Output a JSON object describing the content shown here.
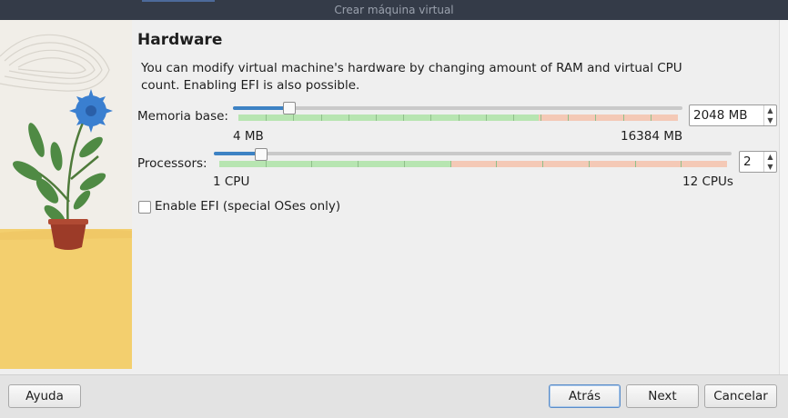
{
  "window": {
    "title": "Crear máquina virtual"
  },
  "page": {
    "heading": "Hardware",
    "description_line1": "You can modify virtual machine's hardware by changing amount of RAM and virtual CPU",
    "description_line2": "count. Enabling EFI is also possible."
  },
  "memory": {
    "label": "Memoria base:",
    "min_label": "4 MB",
    "max_label": "16384 MB",
    "value_text": "2048 MB",
    "value_mb": 2048,
    "min_mb": 4,
    "max_mb": 16384
  },
  "processors": {
    "label": "Processors:",
    "min_label": "1 CPU",
    "max_label": "12 CPUs",
    "value_text": "2",
    "value": 2,
    "min": 1,
    "max": 12
  },
  "efi": {
    "label": "Enable EFI (special OSes only)",
    "checked": false
  },
  "buttons": {
    "help": "Ayuda",
    "back": "Atrás",
    "next": "Next",
    "cancel": "Cancelar"
  },
  "colors": {
    "accent": "#3d82c4",
    "green_zone": "#b7e5b1",
    "red_zone": "#f4c9b6",
    "titlebar": "#343b48"
  },
  "icons": {
    "spin_up": "▲",
    "spin_down": "▼"
  }
}
